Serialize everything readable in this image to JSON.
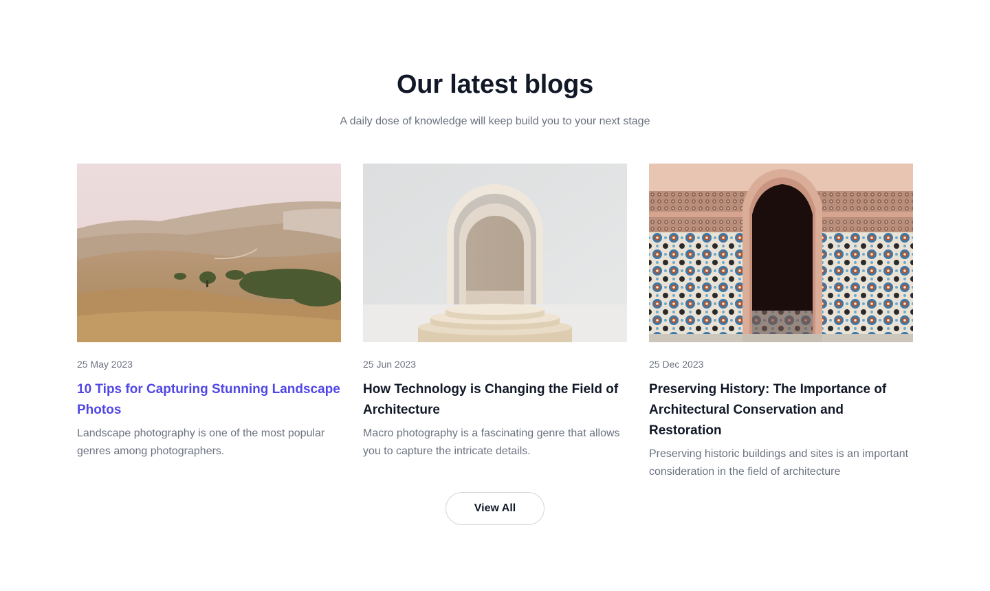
{
  "section": {
    "title": "Our latest blogs",
    "subtitle": "A daily dose of knowledge will keep build you to your next stage"
  },
  "posts": [
    {
      "image": "rolling-hills-landscape-photo",
      "date": "25 May 2023",
      "title": "10 Tips for Capturing Stunning Landscape Photos",
      "excerpt": "Landscape photography is one of the most popular genres among photographers.",
      "highlighted": true
    },
    {
      "image": "nested-arches-podium-render",
      "date": "25 Jun 2023",
      "title": "How Technology is Changing the Field of Architecture",
      "excerpt": "Macro photography is a fascinating genre that allows you to capture the intricate details.",
      "highlighted": false
    },
    {
      "image": "moroccan-tiled-archway-photo",
      "date": "25 Dec 2023",
      "title": "Preserving History: The Importance of Architectural Conservation and Restoration",
      "excerpt": "Preserving historic buildings and sites is an important consideration in the field of architecture",
      "highlighted": false
    }
  ],
  "view_all_label": "View All",
  "colors": {
    "heading": "#111827",
    "muted": "#6b7280",
    "accent": "#5046e5",
    "border": "#d1d5db"
  }
}
